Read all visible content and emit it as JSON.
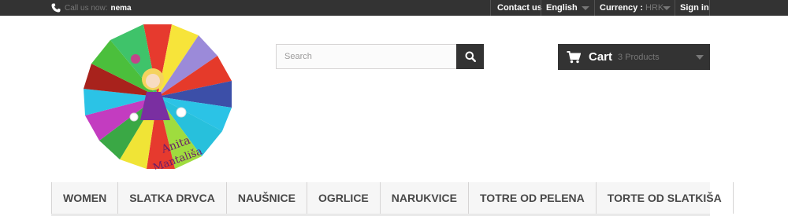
{
  "topbar": {
    "call_label": "Call us now:",
    "call_value": "nema",
    "contact_label": "Contact us",
    "language_value": "English",
    "currency_label": "Currency :",
    "currency_value": "HRK",
    "signin_label": "Sign in"
  },
  "search": {
    "placeholder": "Search"
  },
  "cart": {
    "label": "Cart",
    "count_text": "3 Products"
  },
  "menu": {
    "items": [
      {
        "label": "WOMEN"
      },
      {
        "label": "SLATKA DRVCA"
      },
      {
        "label": "NAUŠNICE"
      },
      {
        "label": "OGRLICE"
      },
      {
        "label": "NARUKVICE"
      },
      {
        "label": "TOTRE OD PELENA"
      },
      {
        "label": "TORTE OD SLATKIŠA"
      }
    ]
  },
  "logo": {
    "icon": "colorful-sunburst-girl-logo",
    "text": "Anita Mantališa"
  }
}
